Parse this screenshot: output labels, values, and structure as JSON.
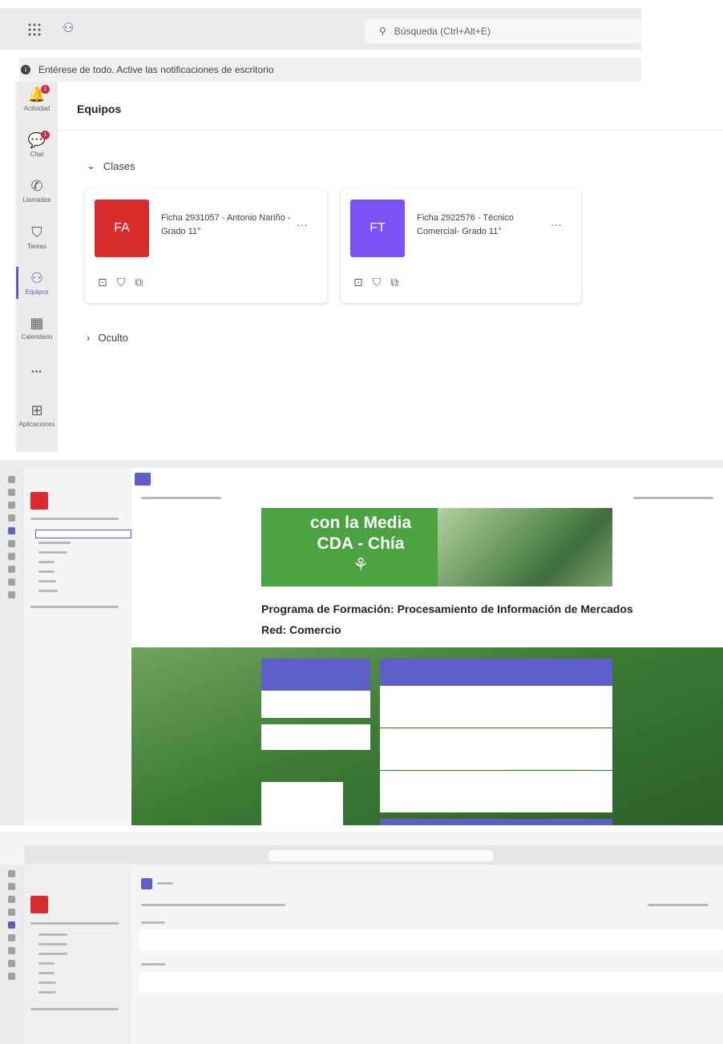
{
  "app": {
    "search_placeholder": "Búsqueda (Ctrl+Alt+E)",
    "notification": "Entérese de todo. Active las notificaciones de escritorio",
    "accent": "#5b5fc7"
  },
  "rail": [
    {
      "label": "Actividad",
      "icon": "bell-icon",
      "glyph": "🔔",
      "badge": "1"
    },
    {
      "label": "Chat",
      "icon": "chat-icon",
      "glyph": "💬",
      "badge": "1"
    },
    {
      "label": "Llamadas",
      "icon": "phone-icon",
      "glyph": "✆"
    },
    {
      "label": "Tareas",
      "icon": "backpack-icon",
      "glyph": "⛉"
    },
    {
      "label": "Equipos",
      "icon": "teams-icon",
      "glyph": "⚇",
      "active": true
    },
    {
      "label": "Calendario",
      "icon": "calendar-icon",
      "glyph": "▦"
    },
    {
      "label": "",
      "icon": "more-icon",
      "glyph": "•••"
    },
    {
      "label": "Aplicaciones",
      "icon": "apps-icon",
      "glyph": "⊞"
    }
  ],
  "teams_page": {
    "title": "Equipos",
    "section_classes": "Clases",
    "section_hidden": "Oculto",
    "cards": [
      {
        "initials": "FA",
        "color": "#d92c2c",
        "name": "Ficha 2931057 - Antonio Nariño - Grado 11°",
        "more": "···"
      },
      {
        "initials": "FT",
        "color": "#7b52f5",
        "name": "Ficha 2922576 - Técnico Comercial- Grado 11°",
        "more": "···"
      }
    ]
  },
  "class_page": {
    "banner_line1": "con la Media",
    "banner_line2": "CDA  - Chía",
    "program_title": "Programa de Formación: Procesamiento de Información de Mercados",
    "network": "Red: Comercio"
  }
}
